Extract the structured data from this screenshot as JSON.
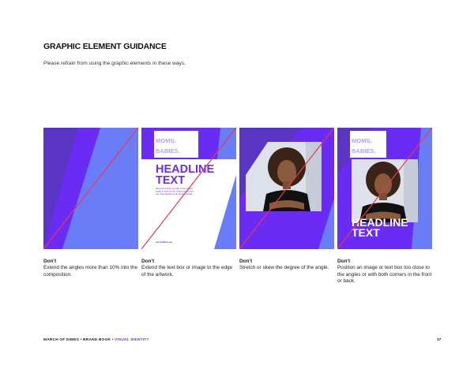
{
  "page": {
    "title": "GRAPHIC ELEMENT GUIDANCE",
    "intro": "Please refrain from using the graphic elements in these ways.",
    "page_number": "37"
  },
  "colors": {
    "purple": "#6a2cf5",
    "periwinkle": "#6b7cf7",
    "dark_purple": "#5a35c4",
    "lavender": "#a9a6f2",
    "strike_red": "#e8384f",
    "paper": "#ffffff"
  },
  "sample": {
    "moms": "MOMS.",
    "babies": "BABIES.",
    "headline_1": "HEADLINE",
    "headline_2": "TEXT",
    "body_lines": [
      "Maecenas id lorem sed diam cursus congue",
      "Integer et tellus vel nisi. Nullam tempus lorem",
      "nec metus dignissim at est faucibus gravida"
    ],
    "url": "marchofdimes.org"
  },
  "photo": {
    "icon": "woman-portrait-photo"
  },
  "examples": [
    {
      "label": "Don't",
      "text": "Extend the angles more than 10% into the composition."
    },
    {
      "label": "Don't",
      "text": "Extend the text box or image to the edge of the artwork."
    },
    {
      "label": "Don't",
      "text": "Stretch or skew the degree of the angle."
    },
    {
      "label": "Don't",
      "text": "Position an image or text box too close to the angles or with both corners in the front or back."
    }
  ],
  "footer": {
    "brand": "MARCH OF DIMES",
    "sep1": " • ",
    "book": "BRAND BOOK",
    "sep2": " • ",
    "section": "VISUAL IDENTITY"
  }
}
